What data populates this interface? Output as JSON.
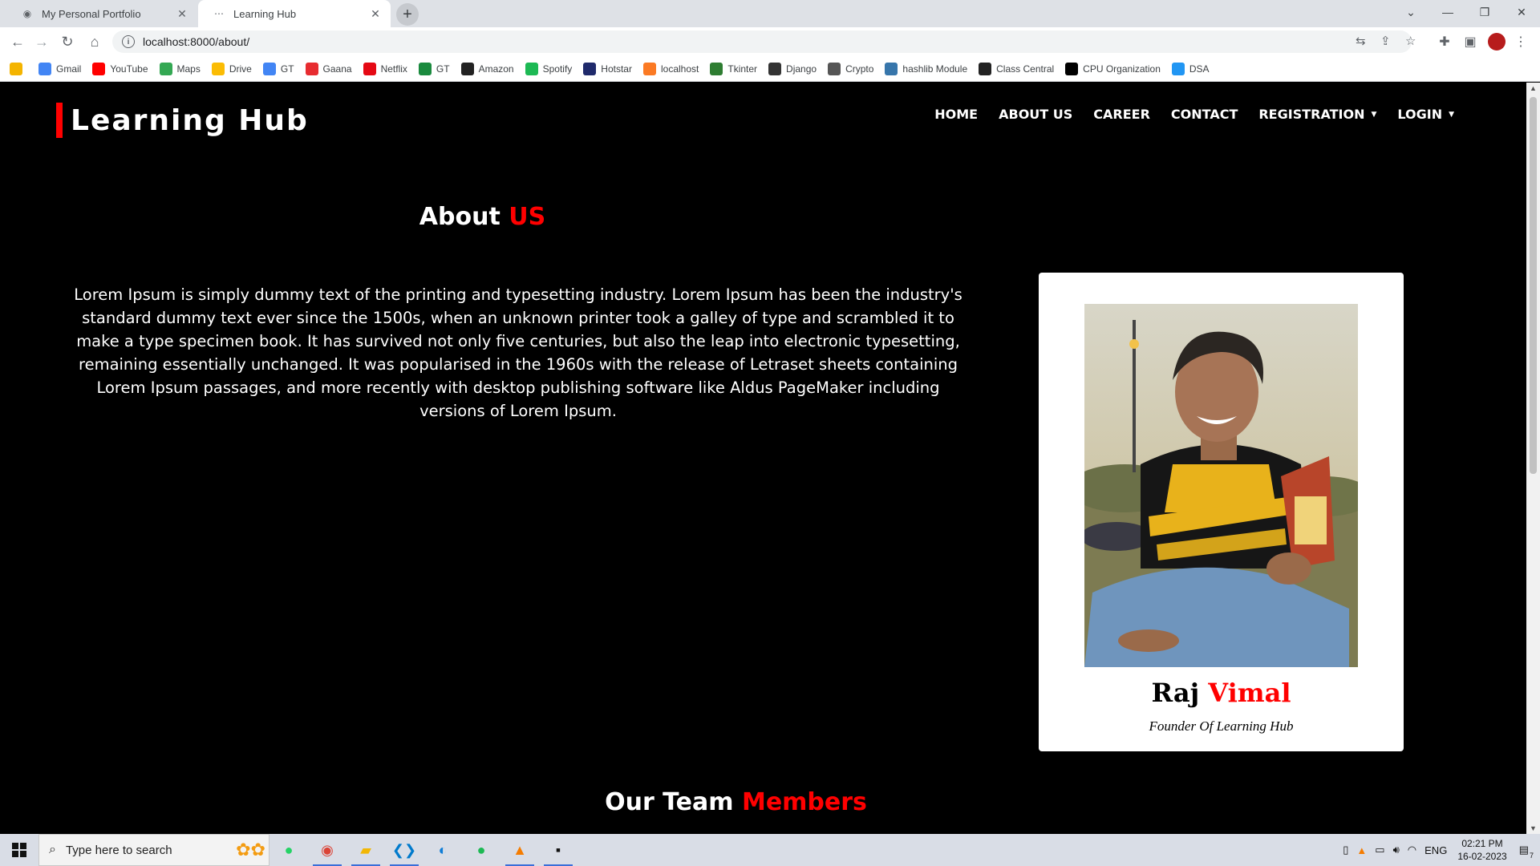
{
  "browser": {
    "tabs": [
      {
        "title": "My Personal Portfolio",
        "active": false
      },
      {
        "title": "Learning Hub",
        "active": true
      }
    ],
    "url": "localhost:8000/about/",
    "bookmarks": [
      {
        "label": "",
        "icon": "ie-icon",
        "color": "#f4b400"
      },
      {
        "label": "Gmail",
        "icon": "google-icon",
        "color": "#4285f4"
      },
      {
        "label": "YouTube",
        "icon": "youtube-icon",
        "color": "#ff0000"
      },
      {
        "label": "Maps",
        "icon": "maps-icon",
        "color": "#34a853"
      },
      {
        "label": "Drive",
        "icon": "drive-icon",
        "color": "#fbbc04"
      },
      {
        "label": "GT",
        "icon": "translate-icon",
        "color": "#4285f4"
      },
      {
        "label": "Gaana",
        "icon": "gaana-icon",
        "color": "#e72c30"
      },
      {
        "label": "Netflix",
        "icon": "netflix-icon",
        "color": "#e50914"
      },
      {
        "label": "GT",
        "icon": "gt-icon",
        "color": "#1a8a3e"
      },
      {
        "label": "Amazon",
        "icon": "amazon-icon",
        "color": "#222222"
      },
      {
        "label": "Spotify",
        "icon": "spotify-icon",
        "color": "#1db954"
      },
      {
        "label": "Hotstar",
        "icon": "hotstar-icon",
        "color": "#1f2a6b"
      },
      {
        "label": "localhost",
        "icon": "xampp-icon",
        "color": "#fb7a24"
      },
      {
        "label": "Tkinter",
        "icon": "tkinter-icon",
        "color": "#2e7d32"
      },
      {
        "label": "Django",
        "icon": "django-icon",
        "color": "#333333"
      },
      {
        "label": "Crypto",
        "icon": "crypto-icon",
        "color": "#555555"
      },
      {
        "label": "hashlib Module",
        "icon": "python-icon",
        "color": "#3776ab"
      },
      {
        "label": "Class Central",
        "icon": "classcentral-icon",
        "color": "#222222"
      },
      {
        "label": "CPU Organization",
        "icon": "cpu-icon",
        "color": "#000000"
      },
      {
        "label": "DSA",
        "icon": "dsa-icon",
        "color": "#2196f3"
      }
    ]
  },
  "site": {
    "brand": "Learning Hub",
    "accent": "#ff0000",
    "nav": [
      {
        "label": "HOME",
        "dropdown": false
      },
      {
        "label": "ABOUT US",
        "dropdown": false
      },
      {
        "label": "CAREER",
        "dropdown": false
      },
      {
        "label": "CONTACT",
        "dropdown": false
      },
      {
        "label": "REGISTRATION",
        "dropdown": true
      },
      {
        "label": "LOGIN",
        "dropdown": true
      }
    ]
  },
  "about": {
    "title_main": "About",
    "title_accent": "US",
    "text": "Lorem Ipsum is simply dummy text of the printing and typesetting industry. Lorem Ipsum has been the industry's standard dummy text ever since the 1500s, when an unknown printer took a galley of type and scrambled it to make a type specimen book. It has survived not only five centuries, but also the leap into electronic typesetting, remaining essentially unchanged. It was popularised in the 1960s with the release of Letraset sheets containing Lorem Ipsum passages, and more recently with desktop publishing software like Aldus PageMaker including versions of Lorem Ipsum."
  },
  "founder": {
    "first_name": "Raj",
    "last_name": "Vimal",
    "role": "Founder Of Learning Hub"
  },
  "team": {
    "title_main": "Our Team",
    "title_accent": "Members"
  },
  "taskbar": {
    "search_placeholder": "Type here to search",
    "language": "ENG",
    "time": "02:21 PM",
    "date": "16-02-2023",
    "notification_count": "7"
  }
}
